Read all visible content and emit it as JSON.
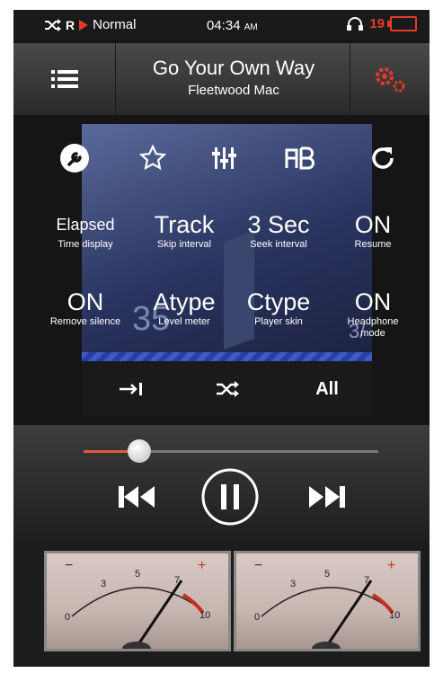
{
  "status": {
    "mode": "Normal",
    "time": "04:34",
    "ampm": "AM",
    "volume": "19",
    "icons": [
      "shuffle-icon",
      "repeat-all-icon",
      "play-state-icon",
      "headphone-db-icon",
      "battery-icon"
    ],
    "colors": {
      "accent": "#e53a2c"
    }
  },
  "header": {
    "title": "Go Your Own Way",
    "artist": "Fleetwood Mac"
  },
  "tabs": [
    "wrench-icon",
    "star-icon",
    "equalizer-icon",
    "ab-repeat-icon",
    "refresh-icon"
  ],
  "settings": [
    {
      "value": "Elapsed",
      "label": "Time display"
    },
    {
      "value": "Track",
      "label": "Skip interval"
    },
    {
      "value": "3 Sec",
      "label": "Seek interval"
    },
    {
      "value": "ON",
      "label": "Resume"
    },
    {
      "value": "ON",
      "label": "Remove silence"
    },
    {
      "value": "Atype",
      "label": "Level meter"
    },
    {
      "value": "Ctype",
      "label": "Player skin"
    },
    {
      "value": "ON",
      "label": "Headphone mode"
    }
  ],
  "art": {
    "number_left": "35",
    "number_right": "3/"
  },
  "bottom_bar": {
    "shuffle_icon": "shuffle-icon",
    "next_icon": "arrow-to-end-icon",
    "repeat_label": "All"
  },
  "player": {
    "progress": 0.19
  },
  "meters": {
    "scale": [
      "0",
      "3",
      "5",
      "7",
      "10"
    ],
    "minus": "−",
    "plus": "+"
  }
}
